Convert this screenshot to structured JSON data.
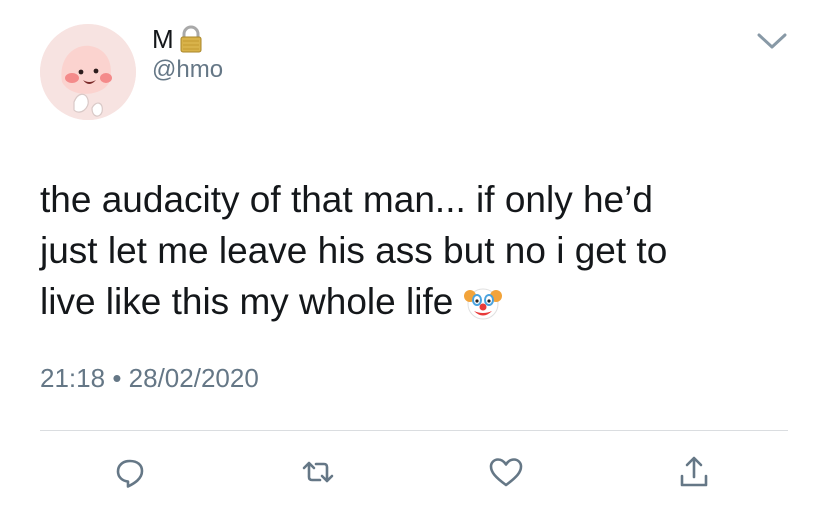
{
  "author": {
    "display_name": "M",
    "handle": "@hmo"
  },
  "tweet": {
    "lines": [
      "the audacity of that man... if only he’d",
      "just let me leave his ass but no i get to",
      "live like this my whole life"
    ],
    "emoji": "clown-face-icon"
  },
  "meta": {
    "time": "21:18",
    "separator": "•",
    "date": "28/02/2020"
  },
  "actions": [
    "reply-icon",
    "retweet-icon",
    "like-icon",
    "share-icon"
  ],
  "colors": {
    "text": "#14171a",
    "secondary": "#657786",
    "divider": "#dadde0"
  }
}
